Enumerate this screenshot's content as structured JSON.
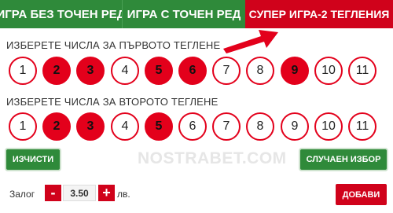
{
  "tabs": [
    {
      "label": "ИГРА БЕЗ ТОЧЕН РЕД"
    },
    {
      "label": "ИГРА С ТОЧЕН РЕД"
    },
    {
      "label": "СУПЕР ИГРА-2 ТЕГЛЕНИЯ"
    }
  ],
  "active_tab": "СУПЕР ИГРА-2 ТЕГЛЕНИЯ",
  "draw1": {
    "heading": "ИЗБЕРЕТЕ ЧИСЛА ЗА ПЪРВОТО ТЕГЛЕНЕ",
    "numbers": [
      "1",
      "2",
      "3",
      "4",
      "5",
      "6",
      "7",
      "8",
      "9",
      "10",
      "11"
    ],
    "selected": [
      2,
      3,
      5,
      6,
      9
    ]
  },
  "draw2": {
    "heading": "ИЗБЕРЕТЕ ЧИСЛА ЗА ВТОРОТО ТЕГЛЕНЕ",
    "numbers": [
      "1",
      "2",
      "3",
      "4",
      "5",
      "6",
      "7",
      "8",
      "9",
      "10",
      "11"
    ],
    "selected": [
      2,
      3,
      5
    ]
  },
  "watermark": "NOSTRABET.COM",
  "buttons": {
    "clear": "ИЗЧИСТИ",
    "random": "СЛУЧАЕН ИЗБОР",
    "add": "ДОБАВИ",
    "minus": "-",
    "plus": "+"
  },
  "stake": {
    "label": "Залог",
    "value": "3.50",
    "currency": "лв."
  },
  "colors": {
    "green": "#2f8a3a",
    "red": "#d0021b"
  },
  "icons": {
    "pointer": "red-arrow-icon"
  }
}
